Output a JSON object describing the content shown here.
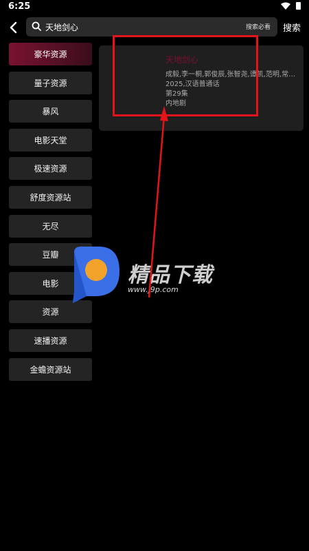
{
  "status_bar": {
    "time": "6:25"
  },
  "search": {
    "query": "天地剑心",
    "hint": "搜索必看",
    "button_label": "搜索"
  },
  "sources": [
    "豪华资源",
    "量子资源",
    "暴风",
    "电影天堂",
    "极速资源",
    "舒度资源站",
    "无尽",
    "豆瓣",
    "电影",
    "资源",
    "速播资源",
    "金蟾资源站"
  ],
  "selected_source_index": 0,
  "result": {
    "title": "天地剑心",
    "cast": "成毅,李一桐,郭俊辰,张智尧,谭凯,范明,常华…",
    "year_lang": "2025,汉语普通话",
    "episode": "第29集",
    "region": "内地剧"
  },
  "watermark": {
    "brand": "精品下载",
    "url": "www.j9p.com"
  },
  "colors": {
    "accent": "#7d1030",
    "annotation": "#e5141b",
    "background": "#000000"
  }
}
